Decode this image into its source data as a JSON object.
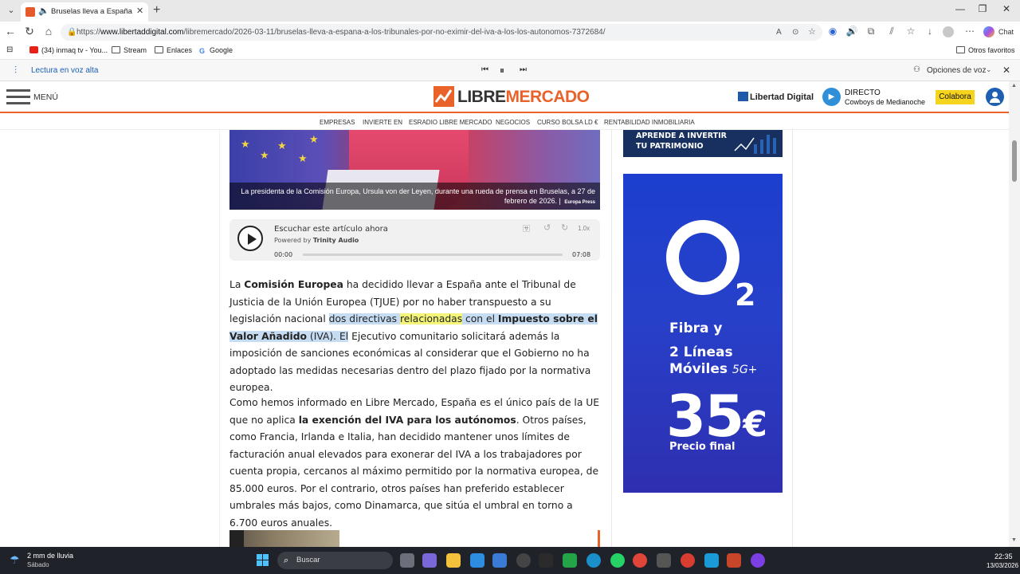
{
  "browser": {
    "tab_title": "Bruselas lleva a España a los t",
    "url_prefix": "https://",
    "url_domain": "www.libertaddigital.com",
    "url_path": "/libremercado/2026-03-11/bruselas-lleva-a-espana-a-los-tribunales-por-no-eximir-del-iva-a-los-los-autonomos-7372684/",
    "chat_label": "Chat",
    "favorites": [
      "(34) inmaq tv - You...",
      "Stream",
      "Enlaces",
      "Google"
    ],
    "other_favorites": "Otros favoritos",
    "read_aloud": "Lectura en voz alta",
    "voice_options": "Opciones de voz"
  },
  "site": {
    "menu_label": "MENÚ",
    "logo_libre": "LIBRE",
    "logo_mercado": "MERCADO",
    "ld_logo": "Libertad Digital",
    "live_title": "DIRECTO",
    "live_show": "Cowboys de Medianoche",
    "collaborate": "Colabora",
    "subnav": [
      "EMPRESAS",
      "INVIERTE EN",
      "ESRADIO LIBRE MERCADO",
      "NEGOCIOS",
      "CURSO BOLSA LD €",
      "RENTABILIDAD INMOBILIARIA"
    ]
  },
  "article": {
    "caption": "La presidenta de la Comisión Europa, Ursula von der Leyen, durante una rueda de prensa en Bruselas, a 27 de febrero de 2026.",
    "caption_source": "Europa Press",
    "player": {
      "title": "Escuchar este artículo ahora",
      "powered_prefix": "Powered by",
      "powered_brand": "Trinity Audio",
      "time_start": "00:00",
      "time_end": "07:08",
      "speed": "1.0x",
      "progress": 0
    },
    "p1": {
      "t1": "La ",
      "b1": "Comisión Europea",
      "t2": " ha decidido llevar a España ante el Tribunal de Justicia de la Unión Europea (TJUE) por no haber transpuesto a su legislación nacional ",
      "sel1": "dos directivas ",
      "sel2": "relacionadas",
      "sel3": " con el ",
      "b2": "Impuesto sobre el Valor Añadido",
      "sel4": " (IVA). El",
      "t3": " Ejecutivo comunitario solicitará además la imposición de sanciones económicas al considerar que el Gobierno no ha adoptado las medidas necesarias dentro del plazo fijado por la normativa europea."
    },
    "p2": {
      "t1": "Como hemos informado en Libre Mercado, España es el único país de la UE que no aplica ",
      "b1": "la exención del IVA para los autónomos",
      "t2": ". Otros países, como Francia, Irlanda e Italia, han decidido mantener unos límites de facturación anual elevados para exonerar del IVA a los trabajadores por cuenta propia, cercanos al máximo permitido por la normativa europea, de 85.000 euros. Por el contrario, otros países han preferido establecer umbrales más bajos, como Dinamarca, que sitúa el umbral en torno a 6.700 euros anuales."
    }
  },
  "ads": {
    "top_line1": "APRENDE A INVERTIR",
    "top_line2": "TU PATRIMONIO",
    "o2_logo_sub": "2",
    "o2_fibra": "Fibra y",
    "o2_lineas": "2 Líneas",
    "o2_moviles": "Móviles",
    "o2_5g": "5G+",
    "o2_price": "35",
    "o2_euro": "€",
    "o2_final": "Precio final"
  },
  "taskbar": {
    "weather": "2 mm de lluvia",
    "day": "Sábado",
    "search": "Buscar",
    "time": "22:35",
    "date": "13/03/2026"
  },
  "colors": {
    "brand_orange": "#e8622a",
    "o2_blue": "#2740c9",
    "selection": "#c6dcf2",
    "highlight": "#f5f57a"
  }
}
